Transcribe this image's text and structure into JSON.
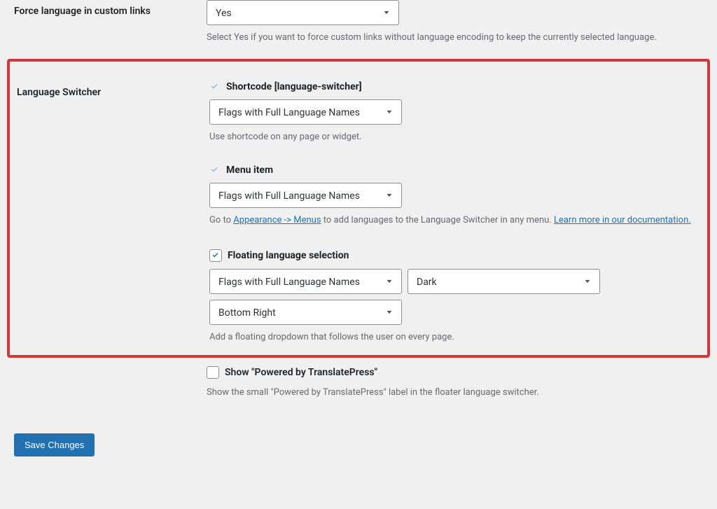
{
  "forceLang": {
    "label": "Force language in custom links",
    "select": "Yes",
    "desc": "Select Yes if you want to force custom links without language encoding to keep the currently selected language."
  },
  "switcher": {
    "label": "Language Switcher",
    "shortcode": {
      "title": "Shortcode [language-switcher]",
      "select": "Flags with Full Language Names",
      "desc": "Use shortcode on any page or widget."
    },
    "menuItem": {
      "title": "Menu item",
      "select": "Flags with Full Language Names",
      "descPre": "Go to ",
      "link1": "Appearance -> Menus",
      "descMid": " to add languages to the Language Switcher in any menu. ",
      "link2": "Learn more in our documentation."
    },
    "floating": {
      "title": "Floating language selection",
      "select1": "Flags with Full Language Names",
      "select2": "Dark",
      "select3": "Bottom Right",
      "desc": "Add a floating dropdown that follows the user on every page."
    }
  },
  "poweredBy": {
    "title": "Show \"Powered by TranslatePress\"",
    "desc": "Show the small \"Powered by TranslatePress\" label in the floater language switcher."
  },
  "saveButton": "Save Changes"
}
